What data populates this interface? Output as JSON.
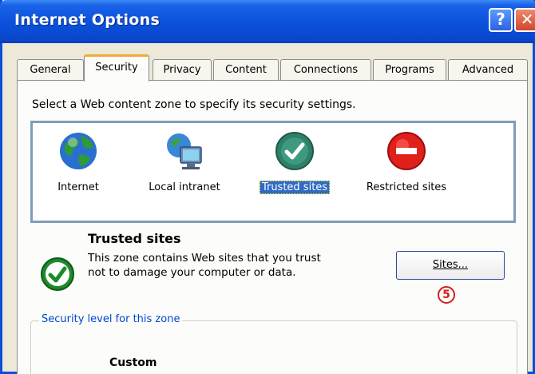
{
  "window": {
    "title": "Internet Options",
    "help_glyph": "?",
    "close_glyph": "✕"
  },
  "tabs": [
    {
      "label": "General"
    },
    {
      "label": "Security"
    },
    {
      "label": "Privacy"
    },
    {
      "label": "Content"
    },
    {
      "label": "Connections"
    },
    {
      "label": "Programs"
    },
    {
      "label": "Advanced"
    }
  ],
  "active_tab": "Security",
  "security": {
    "instruction": "Select a Web content zone to specify its security settings.",
    "zones": [
      {
        "label": "Internet",
        "icon": "globe-icon"
      },
      {
        "label": "Local intranet",
        "icon": "computer-globe-icon"
      },
      {
        "label": "Trusted sites",
        "icon": "checkmark-icon"
      },
      {
        "label": "Restricted sites",
        "icon": "no-entry-icon"
      }
    ],
    "selected_zone": "Trusted sites",
    "zone_title": "Trusted sites",
    "zone_description": "This zone contains Web sites that you trust not to damage your computer or data.",
    "sites_button": "Sites...",
    "marker": "5",
    "security_level_legend": "Security level for this zone",
    "level_name": "Custom"
  },
  "colors": {
    "title_bar": "#0a52dc",
    "selection": "#316ac5",
    "tab_highlight": "#f3a83a",
    "marker": "#d2201a"
  }
}
